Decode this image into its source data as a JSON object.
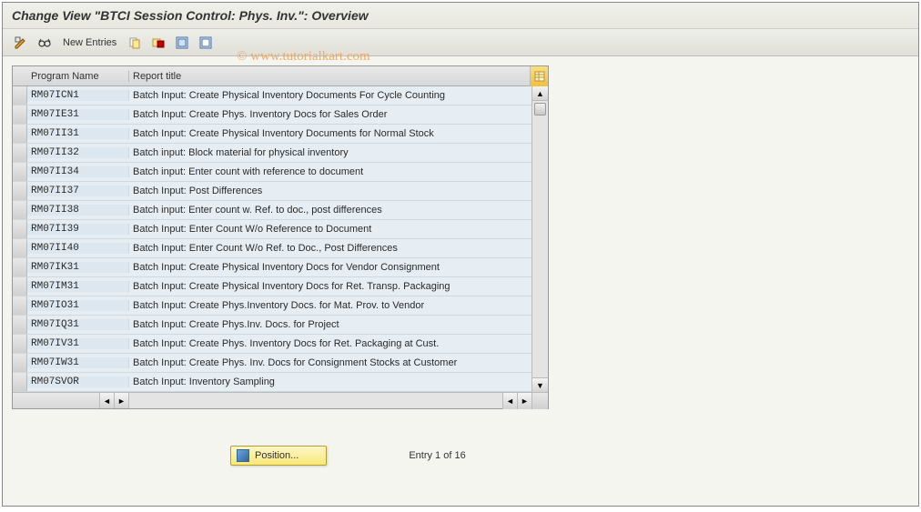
{
  "title": "Change View \"BTCI Session Control: Phys. Inv.\": Overview",
  "watermark": "© www.tutorialkart.com",
  "toolbar": {
    "new_entries_label": "New Entries"
  },
  "table": {
    "col_program": "Program Name",
    "col_title": "Report title",
    "rows": [
      {
        "prog": "RM07ICN1",
        "title": "Batch Input: Create Physical Inventory Documents For Cycle Counting"
      },
      {
        "prog": "RM07IE31",
        "title": "Batch Input: Create Phys. Inventory Docs for Sales Order"
      },
      {
        "prog": "RM07II31",
        "title": "Batch Input: Create Physical Inventory Documents for Normal Stock"
      },
      {
        "prog": "RM07II32",
        "title": "Batch input: Block material for physical inventory"
      },
      {
        "prog": "RM07II34",
        "title": "Batch input: Enter count with reference to document"
      },
      {
        "prog": "RM07II37",
        "title": "Batch Input: Post Differences"
      },
      {
        "prog": "RM07II38",
        "title": "Batch input: Enter count w. Ref. to doc., post differences"
      },
      {
        "prog": "RM07II39",
        "title": "Batch Input: Enter Count W/o Reference to Document"
      },
      {
        "prog": "RM07II40",
        "title": "Batch Input: Enter Count W/o Ref. to Doc., Post Differences"
      },
      {
        "prog": "RM07IK31",
        "title": "Batch Input: Create Physical Inventory Docs for Vendor Consignment"
      },
      {
        "prog": "RM07IM31",
        "title": "Batch Input: Create Physical Inventory Docs for Ret. Transp. Packaging"
      },
      {
        "prog": "RM07IO31",
        "title": "Batch Input: Create Phys.Inventory Docs. for Mat. Prov. to Vendor"
      },
      {
        "prog": "RM07IQ31",
        "title": "Batch Input: Create Phys.Inv. Docs. for Project"
      },
      {
        "prog": "RM07IV31",
        "title": "Batch Input: Create Phys. Inventory Docs for Ret. Packaging at Cust."
      },
      {
        "prog": "RM07IW31",
        "title": "Batch Input: Create Phys. Inv. Docs for Consignment Stocks at Customer"
      },
      {
        "prog": "RM07SVOR",
        "title": "Batch Input: Inventory Sampling"
      }
    ]
  },
  "footer": {
    "position_label": "Position...",
    "entry_text": "Entry 1 of 16"
  }
}
